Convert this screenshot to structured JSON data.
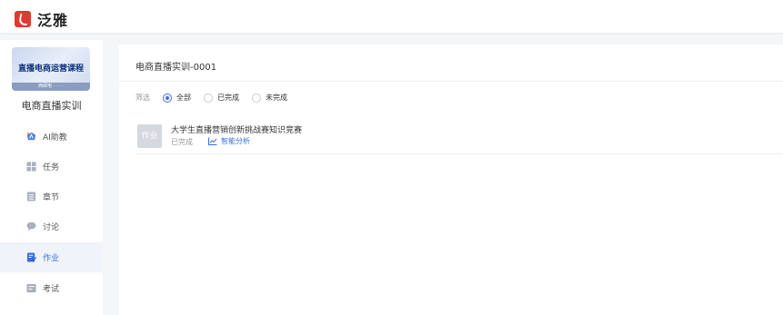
{
  "app": {
    "logo_text": "泛雅"
  },
  "sidebar": {
    "course_card_title": "直播电商运营课程",
    "course_card_strip": "西邮电 · · · ·",
    "course_name": "电商直播实训",
    "items": [
      {
        "label": "AI助教",
        "icon": "ai-assistant-icon",
        "active": false
      },
      {
        "label": "任务",
        "icon": "task-icon",
        "active": false
      },
      {
        "label": "章节",
        "icon": "chapter-icon",
        "active": false
      },
      {
        "label": "讨论",
        "icon": "discussion-icon",
        "active": false
      },
      {
        "label": "作业",
        "icon": "homework-icon",
        "active": true
      },
      {
        "label": "考试",
        "icon": "exam-icon",
        "active": false
      }
    ]
  },
  "main": {
    "title": "电商直播实训-0001",
    "filter": {
      "label": "筛选",
      "options": [
        "全部",
        "已完成",
        "未完成"
      ],
      "selected": "全部"
    },
    "homework": [
      {
        "badge": "作业",
        "title": "大学生直播营销创新挑战赛知识竞赛",
        "status": "已完成",
        "action": "智能分析"
      }
    ]
  },
  "colors": {
    "accent": "#3a6fdc",
    "brand": "#e03a2e"
  }
}
